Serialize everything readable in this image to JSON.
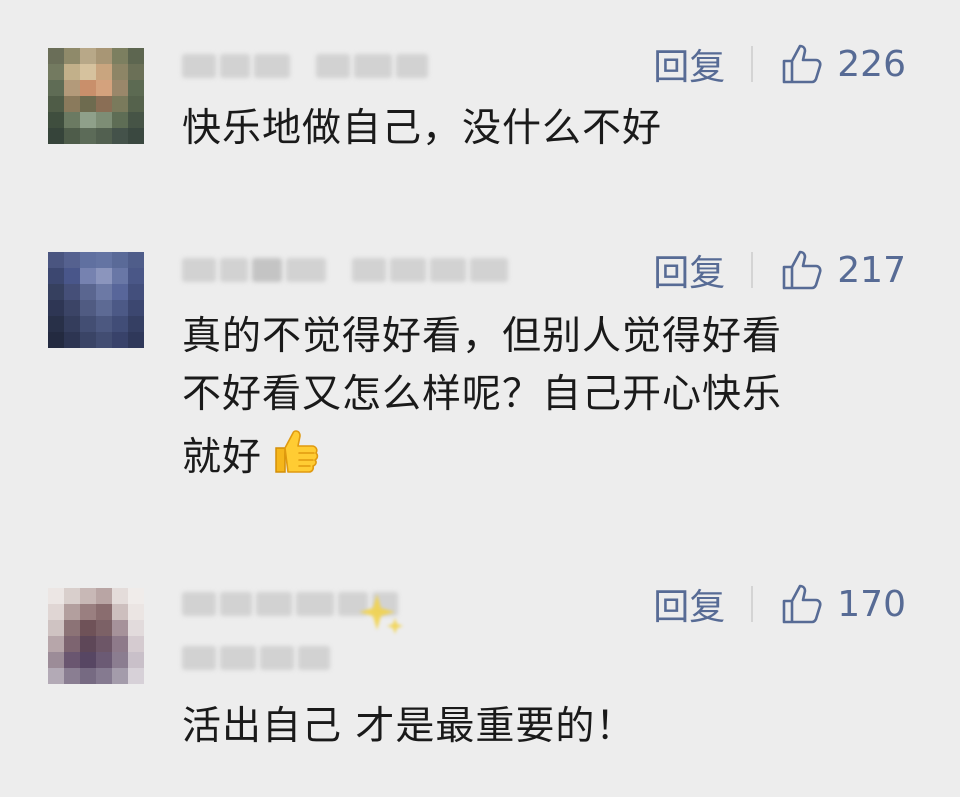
{
  "reply_label": "回复",
  "comments": [
    {
      "likes": "226",
      "text": "快乐地做自己，没什么不好"
    },
    {
      "likes": "217",
      "lines": [
        "真的不觉得好看，但别人觉得好看",
        "不好看又怎么样呢？自己开心快乐",
        "就好"
      ],
      "emoji": "thumbs-up-emoji"
    },
    {
      "likes": "170",
      "text": "活出自己 才是最重要的！"
    }
  ],
  "colors": {
    "background": "#ededed",
    "link_blue": "#576b95",
    "text": "#1a1a1a"
  },
  "icons": {
    "like": "thumbs-up-outline-icon"
  }
}
